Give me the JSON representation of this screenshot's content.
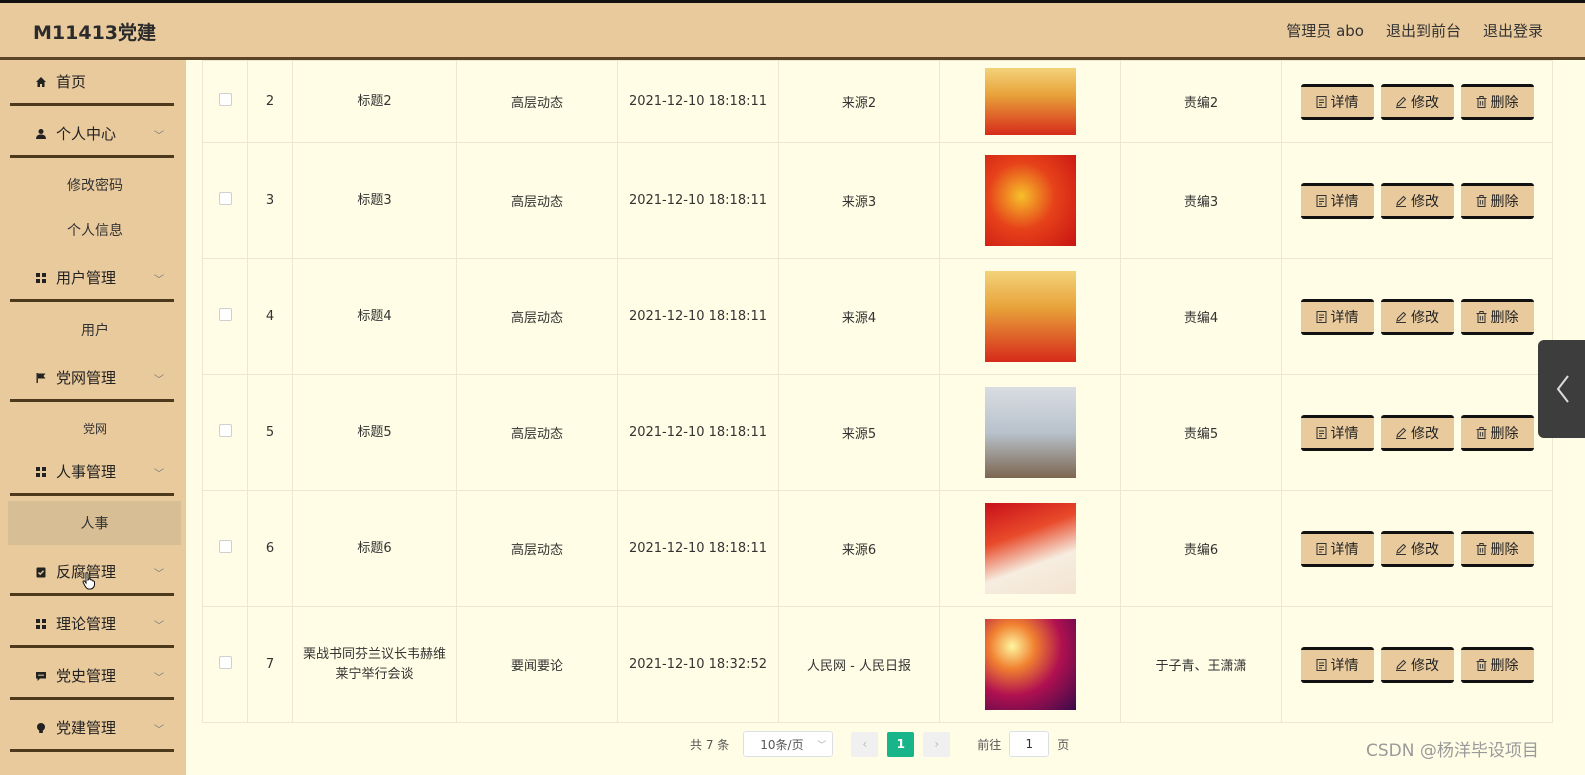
{
  "header": {
    "brand": "M11413党建",
    "user_label": "管理员 abo",
    "front_label": "退出到前台",
    "logout_label": "退出登录"
  },
  "sidebar": {
    "items": [
      {
        "label": "首页",
        "icon": "home-icon"
      },
      {
        "label": "个人中心",
        "icon": "user-icon"
      },
      {
        "label": "修改密码"
      },
      {
        "label": "个人信息"
      },
      {
        "label": "用户管理",
        "icon": "grid-icon"
      },
      {
        "label": "用户"
      },
      {
        "label": "党网管理",
        "icon": "flag-icon"
      },
      {
        "label": "党网"
      },
      {
        "label": "人事管理",
        "icon": "grid-icon"
      },
      {
        "label": "人事"
      },
      {
        "label": "反腐管理",
        "icon": "clipboard-icon"
      },
      {
        "label": "理论管理",
        "icon": "grid-icon"
      },
      {
        "label": "党史管理",
        "icon": "chat-icon"
      },
      {
        "label": "党建管理",
        "icon": "bulb-icon"
      }
    ]
  },
  "table": {
    "rows": [
      {
        "id": "2",
        "title": "标题2",
        "category": "高层动态",
        "time": "2021-12-10 18:18:11",
        "source": "来源2",
        "editor": "责编2"
      },
      {
        "id": "3",
        "title": "标题3",
        "category": "高层动态",
        "time": "2021-12-10 18:18:11",
        "source": "来源3",
        "editor": "责编3"
      },
      {
        "id": "4",
        "title": "标题4",
        "category": "高层动态",
        "time": "2021-12-10 18:18:11",
        "source": "来源4",
        "editor": "责编4"
      },
      {
        "id": "5",
        "title": "标题5",
        "category": "高层动态",
        "time": "2021-12-10 18:18:11",
        "source": "来源5",
        "editor": "责编5"
      },
      {
        "id": "6",
        "title": "标题6",
        "category": "高层动态",
        "time": "2021-12-10 18:18:11",
        "source": "来源6",
        "editor": "责编6"
      },
      {
        "id": "7",
        "title": "栗战书同芬兰议长韦赫维莱宁举行会谈",
        "category": "要闻要论",
        "time": "2021-12-10 18:32:52",
        "source": "人民网 - 人民日报",
        "editor": "于子青、王潇潇"
      }
    ],
    "actions": {
      "detail": "详情",
      "edit": "修改",
      "delete": "删除"
    }
  },
  "pagination": {
    "total": "共 7 条",
    "page_size": "10条/页",
    "current_page": "1",
    "goto_label": "前往",
    "goto_value": "1",
    "page_suffix": "页"
  },
  "watermark": "CSDN @杨洋毕设项目",
  "colors": {
    "accent": "#e9ca9d",
    "page_bg": "#fffde5",
    "active_page": "#18b48a",
    "border_dark": "#111111"
  }
}
